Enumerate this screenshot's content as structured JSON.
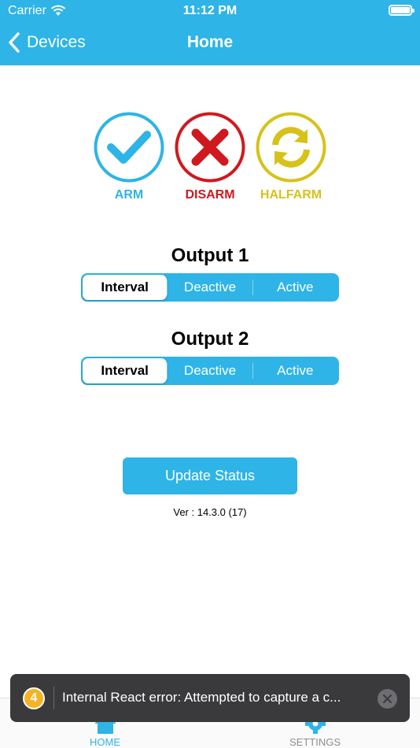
{
  "status_bar": {
    "carrier": "Carrier",
    "time": "11:12 PM"
  },
  "nav": {
    "back_label": "Devices",
    "title": "Home"
  },
  "modes": [
    {
      "label": "ARM",
      "icon": "checkmark-icon",
      "color": "#2eb4e6"
    },
    {
      "label": "DISARM",
      "icon": "x-icon",
      "color": "#d0191f"
    },
    {
      "label": "HALFARM",
      "icon": "sync-icon",
      "color": "#d6c21a"
    }
  ],
  "outputs": [
    {
      "title": "Output 1",
      "options": [
        "Interval",
        "Deactive",
        "Active"
      ],
      "selected": "Interval"
    },
    {
      "title": "Output 2",
      "options": [
        "Interval",
        "Deactive",
        "Active"
      ],
      "selected": "Interval"
    }
  ],
  "update_button": "Update Status",
  "version": "Ver : 14.3.0 (17)",
  "tabs": [
    {
      "label": "HOME",
      "icon": "home-icon",
      "active": true
    },
    {
      "label": "SETTINGS",
      "icon": "settings-icon",
      "active": false
    }
  ],
  "error_toast": {
    "count": "4",
    "message": "Internal React error: Attempted to capture a c..."
  },
  "colors": {
    "accent": "#2eb4e6",
    "disarm": "#d0191f",
    "halfarm": "#d6c21a"
  }
}
